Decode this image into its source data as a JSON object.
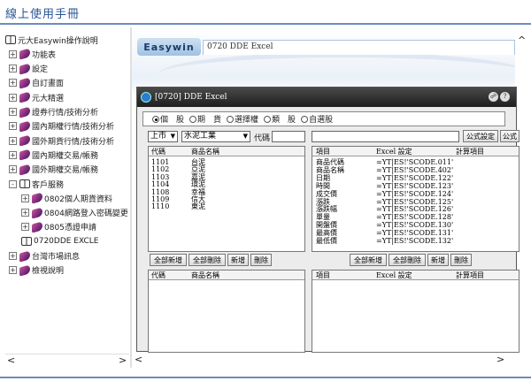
{
  "page": {
    "title": "線上使用手冊"
  },
  "tree": [
    {
      "label": "元大Easywin操作說明",
      "icon": "open-book-icon",
      "expander": ""
    },
    {
      "label": "功能表",
      "icon": "book-icon",
      "expander": "+"
    },
    {
      "label": "設定",
      "icon": "book-icon",
      "expander": "+"
    },
    {
      "label": "自訂畫面",
      "icon": "book-icon",
      "expander": "+"
    },
    {
      "label": "元大精選",
      "icon": "book-icon",
      "expander": "+"
    },
    {
      "label": "證券行情/技術分析",
      "icon": "book-icon",
      "expander": "+"
    },
    {
      "label": "國內期權行情/技術分析",
      "icon": "book-icon",
      "expander": "+"
    },
    {
      "label": "國外期貨行情/技術分析",
      "icon": "book-icon",
      "expander": "+"
    },
    {
      "label": "國內期權交易/帳務",
      "icon": "book-icon",
      "expander": "+"
    },
    {
      "label": "國外期權交易/帳務",
      "icon": "book-icon",
      "expander": "+"
    },
    {
      "label": "客戶服務",
      "icon": "open-book-icon",
      "expander": "-"
    },
    {
      "label": "0802個人期貨資料",
      "icon": "book-icon",
      "expander": "+"
    },
    {
      "label": "0804網路登入密碼變更",
      "icon": "book-icon",
      "expander": "+"
    },
    {
      "label": "0805憑證申請",
      "icon": "book-icon",
      "expander": "+"
    },
    {
      "label": "0720DDE EXCLE",
      "icon": "open-book-icon",
      "expander": ""
    },
    {
      "label": "台灣市場訊息",
      "icon": "book-icon",
      "expander": "+"
    },
    {
      "label": "檢視說明",
      "icon": "book-icon",
      "expander": "+"
    }
  ],
  "banner": {
    "brand": "Easywin",
    "topic_title": "0720 DDE Excel"
  },
  "dde": {
    "title": "[0720] DDE Excel",
    "radios": [
      {
        "label": "個　股",
        "checked": true
      },
      {
        "label": "期　貨",
        "checked": false
      },
      {
        "label": "選擇權",
        "checked": false
      },
      {
        "label": "類　股",
        "checked": false
      },
      {
        "label": "自選股",
        "checked": false
      }
    ],
    "market": "上市",
    "industry": "水泥工業",
    "code_label": "代碼",
    "btn_formula_set": "公式設定",
    "btn_formula_cut": "公式",
    "left_cols": [
      "代碼",
      "商品名稱"
    ],
    "stocks": [
      [
        "1101",
        "台泥"
      ],
      [
        "1102",
        "亞泥"
      ],
      [
        "1103",
        "嘉泥"
      ],
      [
        "1104",
        "環泥"
      ],
      [
        "1108",
        "幸福"
      ],
      [
        "1109",
        "信大"
      ],
      [
        "1110",
        "東泥"
      ]
    ],
    "right_cols": [
      "項目",
      "Excel 設定",
      "計算項目"
    ],
    "items": [
      [
        "商品代碼",
        "=YT|ES!'SCODE.011'"
      ],
      [
        "商品名稱",
        "=YT|ES!'SCODE.402'"
      ],
      [
        "日期",
        "=YT|ES!'SCODE.122'"
      ],
      [
        "時間",
        "=YT|ES!'SCODE.123'"
      ],
      [
        "成交價",
        "=YT|ES!'SCODE.124'"
      ],
      [
        "漲跌",
        "=YT|ES!'SCODE.125'"
      ],
      [
        "漲跌幅",
        "=YT|ES!'SCODE.126'"
      ],
      [
        "單量",
        "=YT|ES!'SCODE.128'"
      ],
      [
        "開盤價",
        "=YT|ES!'SCODE.130'"
      ],
      [
        "最高價",
        "=YT|ES!'SCODE.131'"
      ],
      [
        "最低價",
        "=YT|ES!'SCODE.132'"
      ]
    ],
    "buttons": [
      "全部新增",
      "全部刪除",
      "新增",
      "刪除"
    ]
  }
}
